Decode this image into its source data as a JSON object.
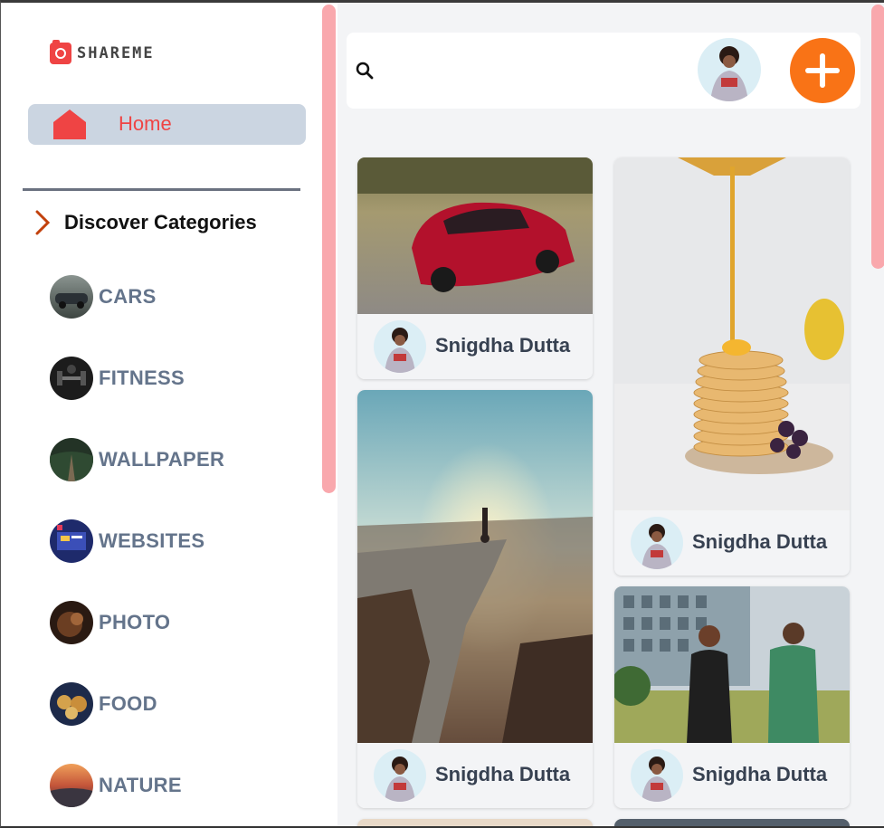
{
  "app": {
    "logo_text": "SHAREME"
  },
  "sidebar": {
    "home_label": "Home",
    "discover_label": "Discover Categories",
    "categories": [
      {
        "label": "CARS"
      },
      {
        "label": "FITNESS"
      },
      {
        "label": "WALLPAPER"
      },
      {
        "label": "WEBSITES"
      },
      {
        "label": "PHOTO"
      },
      {
        "label": "FOOD"
      },
      {
        "label": "NATURE"
      }
    ]
  },
  "colors": {
    "accent": "#ef4444",
    "active_bg": "#cbd5e1",
    "add_button": "#f97316",
    "scrollbar": "#f9a8ad",
    "category_text": "#64748b"
  },
  "pins": [
    {
      "image": "red sports car on road",
      "author": "Snigdha Dutta"
    },
    {
      "image": "pancake stack with syrup",
      "author": "Snigdha Dutta"
    },
    {
      "image": "handstand on cliff at sunset",
      "author": "Snigdha Dutta"
    },
    {
      "image": "couple running outdoors",
      "author": "Snigdha Dutta"
    }
  ]
}
